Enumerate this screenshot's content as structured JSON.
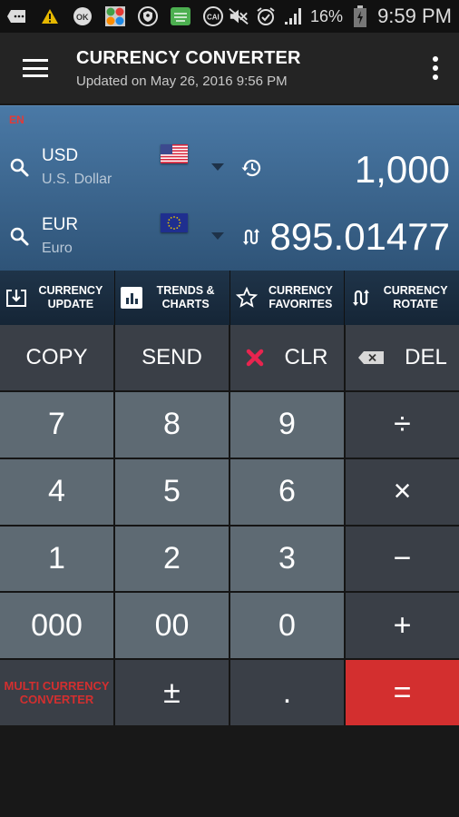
{
  "status_bar": {
    "left_icons": [
      "chat-bubble-icon",
      "warning-icon",
      "ok-google-icon",
      "currency-app-icon",
      "vpn-shield-icon",
      "keyboard-icon",
      "cai-icon"
    ],
    "right_icons": [
      "mute-icon",
      "alarm-icon",
      "signal-icon"
    ],
    "battery": "16%",
    "time": "9:59 PM"
  },
  "app_bar": {
    "title": "CURRENCY CONVERTER",
    "subtitle": "Updated on May 26, 2016 9:56 PM"
  },
  "converter": {
    "language": "EN",
    "from": {
      "code": "USD",
      "name": "U.S. Dollar",
      "flag": "us-flag",
      "amount": "1,000",
      "aux_icon": "history-icon"
    },
    "to": {
      "code": "EUR",
      "name": "Euro",
      "flag": "eu-flag",
      "amount": "895.01477",
      "aux_icon": "swap-icon"
    }
  },
  "actions": [
    {
      "line1": "CURRENCY",
      "line2": "UPDATE",
      "icon": "download-icon"
    },
    {
      "line1": "TRENDS &",
      "line2": "CHARTS",
      "icon": "bar-chart-icon"
    },
    {
      "line1": "CURRENCY",
      "line2": "FAVORITES",
      "icon": "star-icon"
    },
    {
      "line1": "CURRENCY",
      "line2": "ROTATE",
      "icon": "rotate-icon"
    }
  ],
  "keypad": {
    "copy": "COPY",
    "send": "SEND",
    "clr": "CLR",
    "del": "DEL",
    "k7": "7",
    "k8": "8",
    "k9": "9",
    "divide": "÷",
    "k4": "4",
    "k5": "5",
    "k6": "6",
    "multiply": "×",
    "k1": "1",
    "k2": "2",
    "k3": "3",
    "minus": "−",
    "k000": "000",
    "k00": "00",
    "k0": "0",
    "plus": "+",
    "multi_line1": "MULTI CURRENCY",
    "multi_line2": "CONVERTER",
    "plusminus": "±",
    "dot": ".",
    "equals": "="
  },
  "colors": {
    "accent_red": "#d32f2f",
    "panel_blue": "#4a79a6",
    "number_key": "#5e6a73",
    "function_key": "#3a3f47"
  }
}
